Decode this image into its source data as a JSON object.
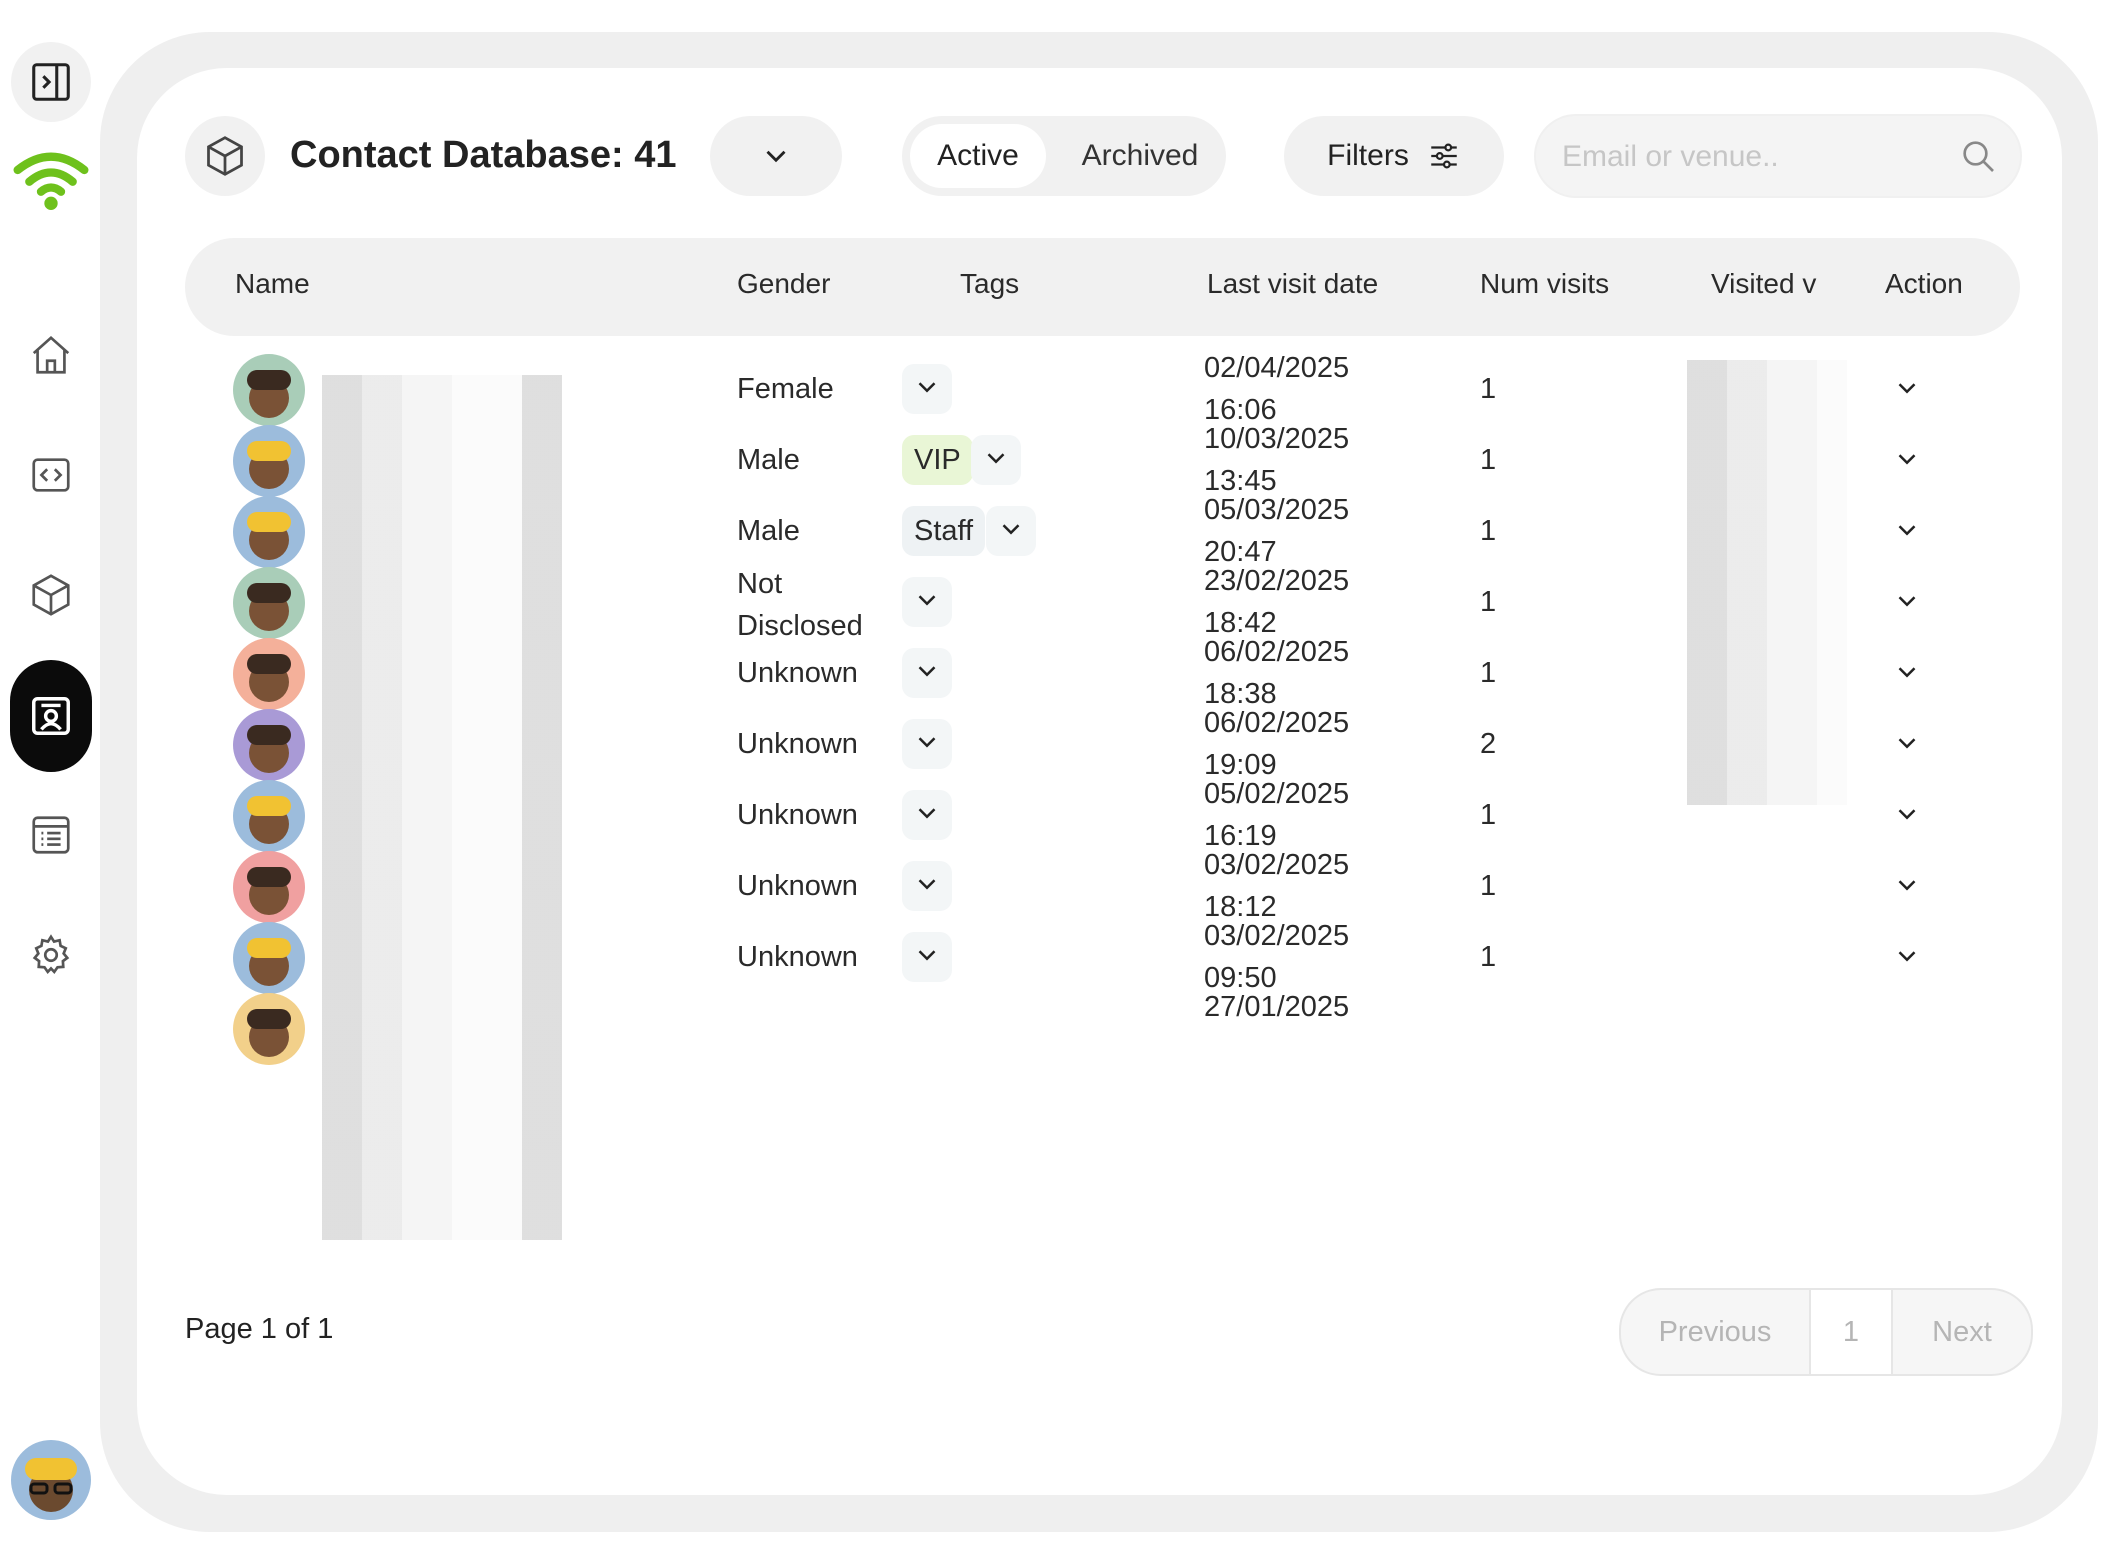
{
  "header": {
    "title": "Contact Database: 41",
    "tabs": {
      "active": "Active",
      "archived": "Archived"
    },
    "filters_label": "Filters",
    "search_placeholder": "Email or venue.."
  },
  "table": {
    "columns": {
      "name": "Name",
      "gender": "Gender",
      "tags": "Tags",
      "last_visit": "Last visit date",
      "num_visits": "Num visits",
      "visited": "Visited v",
      "action": "Action"
    },
    "rows": [
      {
        "avatar": "avatar-memoji-woman",
        "gender": "Female",
        "tag": "",
        "date": "02/04/2025",
        "time": "16:06",
        "visits": "1"
      },
      {
        "avatar": "avatar-memoji-hardhat",
        "gender": "Male",
        "tag": "VIP",
        "date": "10/03/2025",
        "time": "13:45",
        "visits": "1"
      },
      {
        "avatar": "avatar-memoji-hardhat",
        "gender": "Male",
        "tag": "Staff",
        "date": "05/03/2025",
        "time": "20:47",
        "visits": "1"
      },
      {
        "avatar": "avatar-memoji-hearts",
        "gender_line1": "Not",
        "gender_line2": "Disclosed",
        "tag": "",
        "date": "23/02/2025",
        "time": "18:42",
        "visits": "1"
      },
      {
        "avatar": "avatar-memoji-cap",
        "gender": "Unknown",
        "tag": "",
        "date": "06/02/2025",
        "time": "18:38",
        "visits": "1"
      },
      {
        "avatar": "avatar-memoji-turban",
        "gender": "Unknown",
        "tag": "",
        "date": "06/02/2025",
        "time": "19:09",
        "visits": "2"
      },
      {
        "avatar": "avatar-memoji-hardhat",
        "gender": "Unknown",
        "tag": "",
        "date": "05/02/2025",
        "time": "16:19",
        "visits": "1"
      },
      {
        "avatar": "avatar-memoji-surprised",
        "gender": "Unknown",
        "tag": "",
        "date": "03/02/2025",
        "time": "18:12",
        "visits": "1"
      },
      {
        "avatar": "avatar-memoji-hardhat",
        "gender": "Unknown",
        "tag": "",
        "date": "03/02/2025",
        "time": "09:50",
        "visits": "1"
      },
      {
        "avatar": "avatar-memoji-partial",
        "gender": "",
        "tag": "",
        "date": "27/01/2025",
        "time": "",
        "visits": ""
      }
    ]
  },
  "footer": {
    "page_info": "Page 1 of 1",
    "previous": "Previous",
    "current_page": "1",
    "next": "Next"
  },
  "colors": {
    "brand_green": "#6ec11c",
    "vip_tag": "#e9f6d6",
    "nav_active": "#0b0b0b"
  }
}
